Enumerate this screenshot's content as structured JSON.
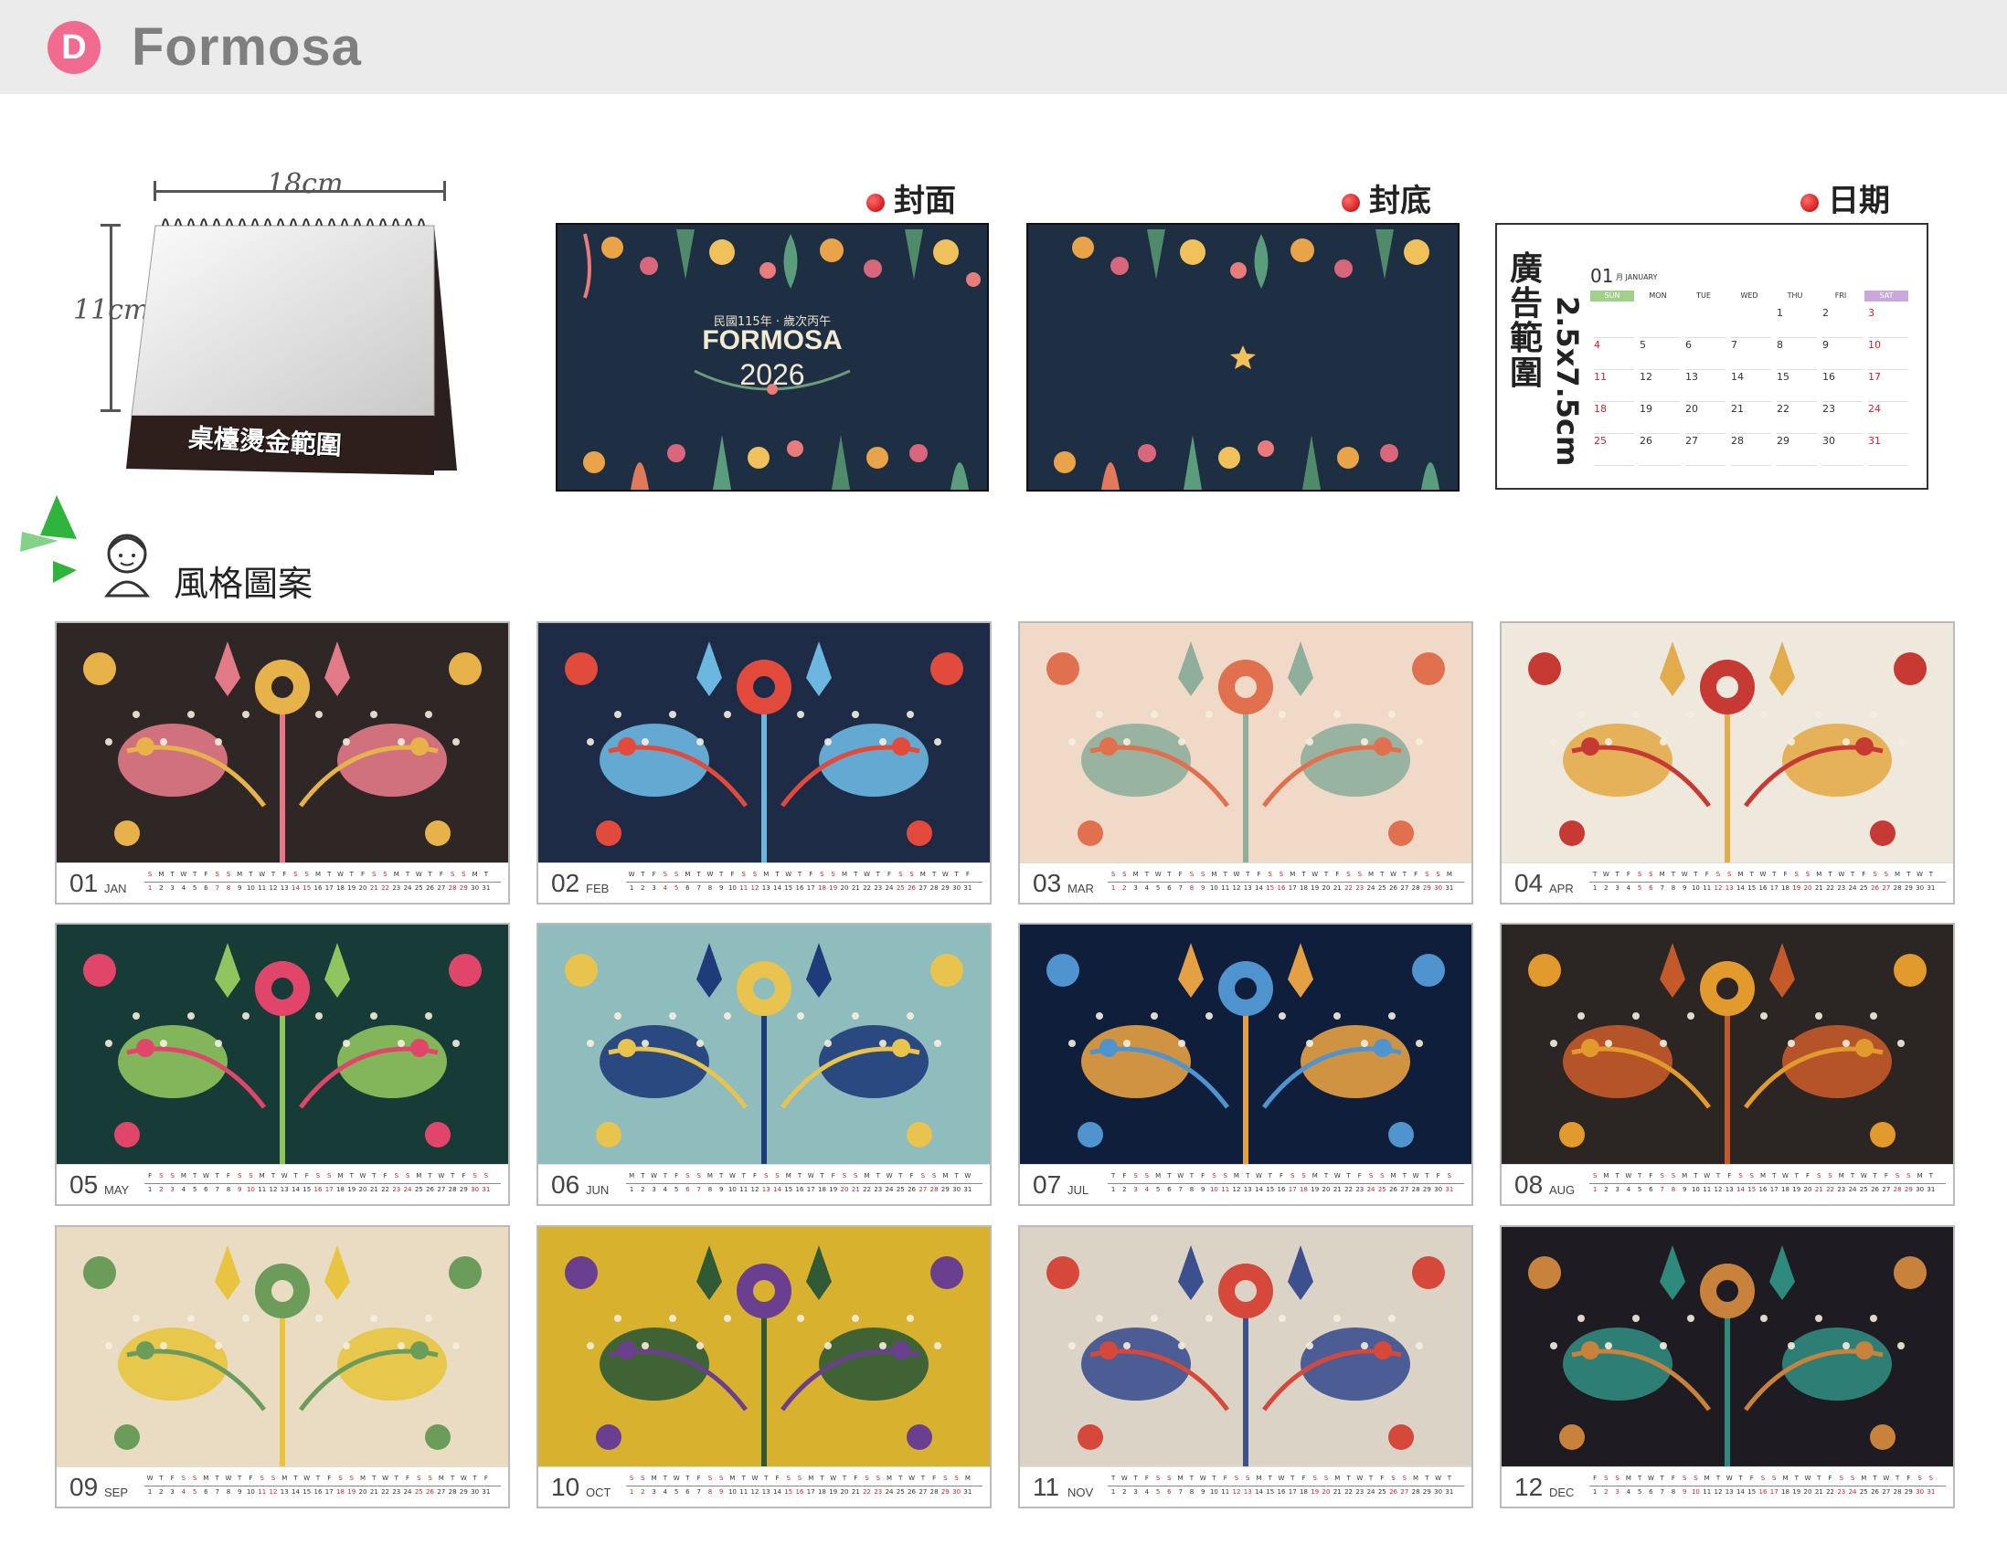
{
  "header": {
    "badge": "D",
    "brand": "Formosa"
  },
  "desk": {
    "width_label": "18cm",
    "height_label": "11cm",
    "foil_label": "桌檯燙金範圍"
  },
  "sections": {
    "cover": "封面",
    "back": "封底",
    "date": "日期",
    "style": "風格圖案"
  },
  "cover": {
    "subtitle": "民國115年 · 歲次丙午",
    "title": "FORMOSA",
    "year": "2026"
  },
  "date_page": {
    "ad_label": "廣告範圍",
    "ad_size": "2.5x7.5cm",
    "month_num": "01",
    "month_name": "月 JANUARY",
    "weekdays": [
      "SUN",
      "MON",
      "TUE",
      "WED",
      "THU",
      "FRI",
      "SAT"
    ],
    "rows": [
      [
        "",
        "",
        "",
        "",
        "1",
        "2",
        "3"
      ],
      [
        "4",
        "5",
        "6",
        "7",
        "8",
        "9",
        "10"
      ],
      [
        "11",
        "12",
        "13",
        "14",
        "15",
        "16",
        "17"
      ],
      [
        "18",
        "19",
        "20",
        "21",
        "22",
        "23",
        "24"
      ],
      [
        "25",
        "26",
        "27",
        "28",
        "29",
        "30",
        "31"
      ]
    ]
  },
  "colors": {
    "accent": "#f06b8f",
    "holiday": "#d21f2f",
    "cover_bg": "#1e2f43"
  },
  "months": [
    {
      "num": "01",
      "name": "JAN",
      "bg": "#2f2725",
      "accent": "#e7b24a",
      "accent2": "#e37a88"
    },
    {
      "num": "02",
      "name": "FEB",
      "bg": "#1d2b47",
      "accent": "#e24a3c",
      "accent2": "#6bb7e0"
    },
    {
      "num": "03",
      "name": "MAR",
      "bg": "#f0d9c6",
      "accent": "#e0704e",
      "accent2": "#8fae9c"
    },
    {
      "num": "04",
      "name": "APR",
      "bg": "#efe8dd",
      "accent": "#c73a34",
      "accent2": "#e3ac4a"
    },
    {
      "num": "05",
      "name": "MAY",
      "bg": "#173b36",
      "accent": "#e2456a",
      "accent2": "#8fc45e"
    },
    {
      "num": "06",
      "name": "JUN",
      "bg": "#8fbcbd",
      "accent": "#e8c44f",
      "accent2": "#1f3c7a"
    },
    {
      "num": "07",
      "name": "JUL",
      "bg": "#0e1e3b",
      "accent": "#4f93cf",
      "accent2": "#e4a043"
    },
    {
      "num": "08",
      "name": "AUG",
      "bg": "#2b2523",
      "accent": "#e39a2c",
      "accent2": "#c45a2a"
    },
    {
      "num": "09",
      "name": "SEP",
      "bg": "#e9dcc2",
      "accent": "#6c9c5a",
      "accent2": "#e8c440"
    },
    {
      "num": "10",
      "name": "OCT",
      "bg": "#d8b22e",
      "accent": "#6b3f8f",
      "accent2": "#2f5a35"
    },
    {
      "num": "11",
      "name": "NOV",
      "bg": "#dcd3c7",
      "accent": "#d6493a",
      "accent2": "#3c4f8f"
    },
    {
      "num": "12",
      "name": "DEC",
      "bg": "#1f1b22",
      "accent": "#c9823c",
      "accent2": "#2f8a7e"
    }
  ]
}
